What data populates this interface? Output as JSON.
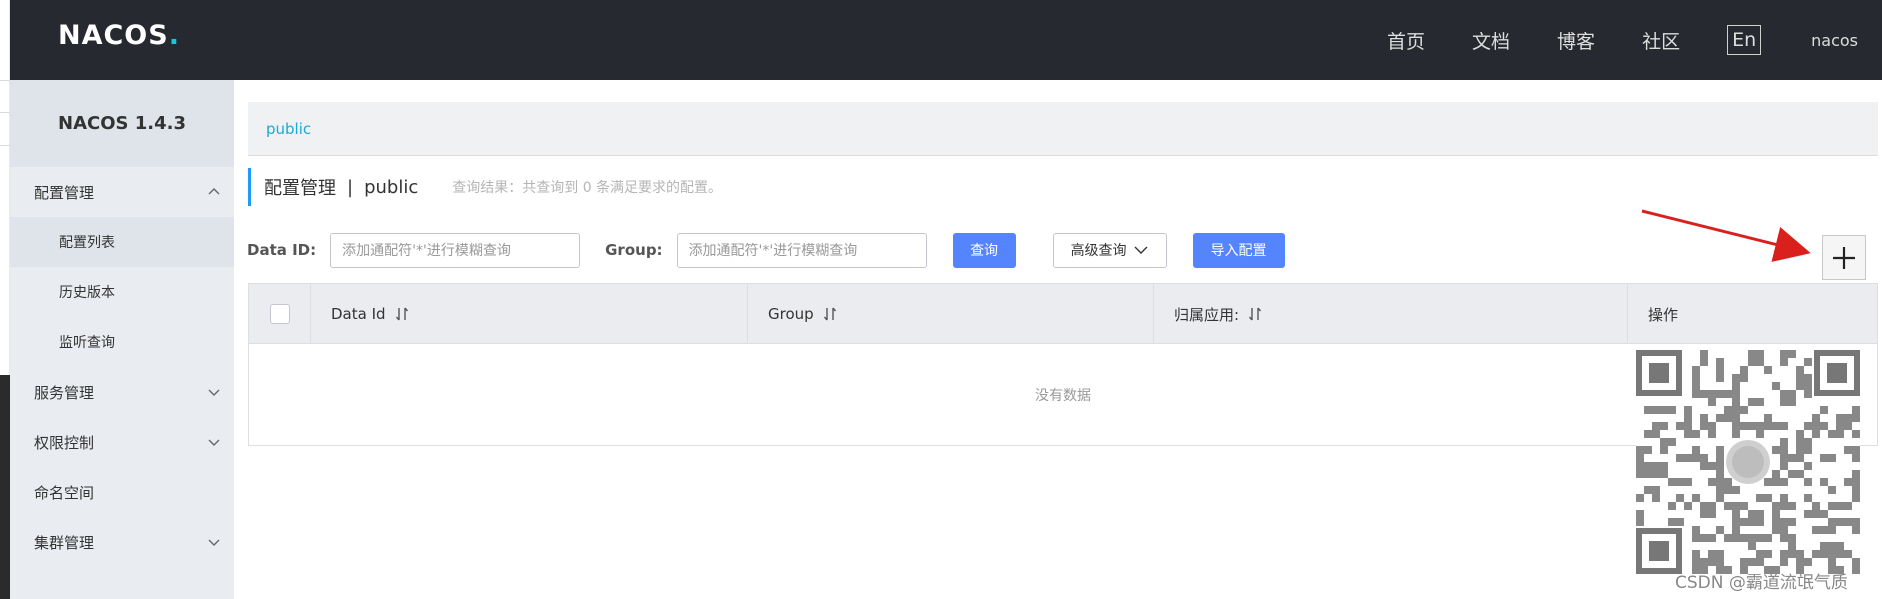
{
  "header": {
    "logo": "NACOS",
    "logo_dot": ".",
    "nav": [
      "首页",
      "文档",
      "博客",
      "社区"
    ],
    "lang": "En",
    "user": "nacos"
  },
  "sidebar": {
    "version": "NACOS 1.4.3",
    "groups": [
      {
        "label": "配置管理",
        "expanded": true,
        "items": [
          "配置列表",
          "历史版本",
          "监听查询"
        ]
      },
      {
        "label": "服务管理",
        "expanded": false
      },
      {
        "label": "权限控制",
        "expanded": false
      },
      {
        "label": "命名空间"
      },
      {
        "label": "集群管理",
        "expanded": false
      }
    ]
  },
  "main": {
    "namespace_tab": "public",
    "title": "配置管理",
    "title_sep": "|",
    "namespace": "public",
    "result_hint": "查询结果：共查询到 0 条满足要求的配置。",
    "filters": {
      "data_id_label": "Data ID:",
      "data_id_placeholder": "添加通配符'*'进行模糊查询",
      "group_label": "Group:",
      "group_placeholder": "添加通配符'*'进行模糊查询",
      "query_button": "查询",
      "advanced_button": "高级查询",
      "import_button": "导入配置"
    },
    "table": {
      "columns": [
        "Data Id",
        "Group",
        "归属应用:",
        "操作"
      ],
      "empty_text": "没有数据"
    }
  },
  "watermark": "CSDN @霸道流氓气质",
  "colors": {
    "topbar": "#262a30",
    "sidebar": "#e9edf1",
    "primary": "#5584ff",
    "accent": "#1aa9d8",
    "annotation_arrow": "#d9201c"
  }
}
